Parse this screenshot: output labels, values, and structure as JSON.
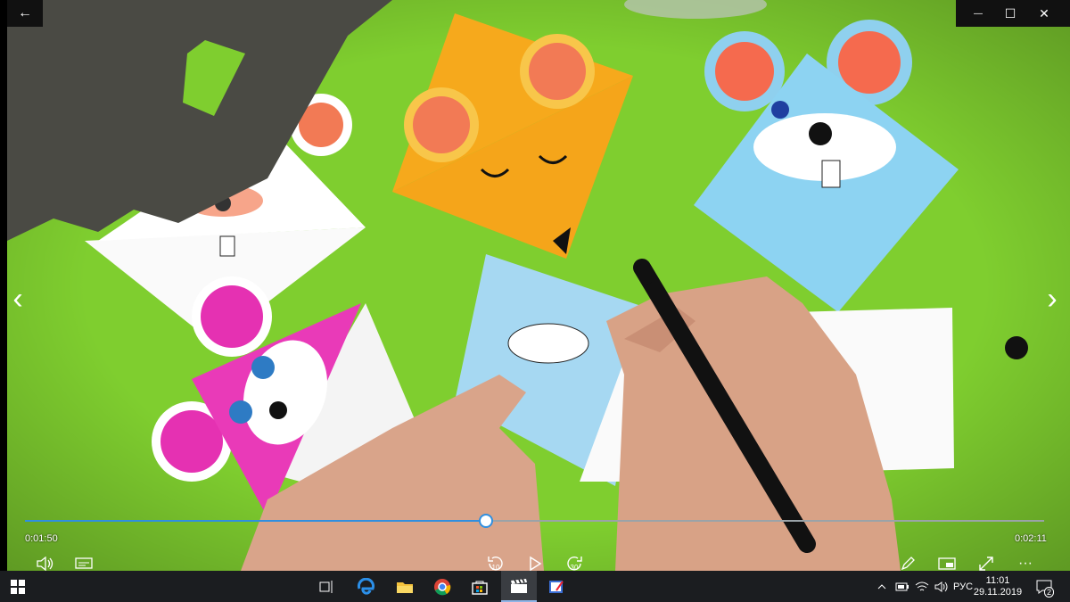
{
  "window": {
    "back_label": "←",
    "minimize_label": "—",
    "maximize_label": "☐",
    "close_label": "✕"
  },
  "player": {
    "current_time": "0:01:50",
    "total_time": "0:02:11",
    "progress": 0.4524,
    "prev_label": "‹",
    "next_label": "›",
    "skip_back_seconds": "10",
    "skip_forward_seconds": "30",
    "more_label": "···"
  },
  "taskbar": {
    "apps": [
      "windows-start",
      "task-view",
      "edge",
      "file-explorer",
      "chrome",
      "store",
      "movies-tv",
      "paint"
    ],
    "active_app": "movies-tv",
    "language": "РУС",
    "clock_time": "11:01",
    "clock_date": "29.11.2019",
    "notification_count": "2"
  },
  "colors": {
    "background_green": "#7fce2f",
    "accent_blue": "#2f8fe0",
    "taskbar": "#1b1d20"
  }
}
